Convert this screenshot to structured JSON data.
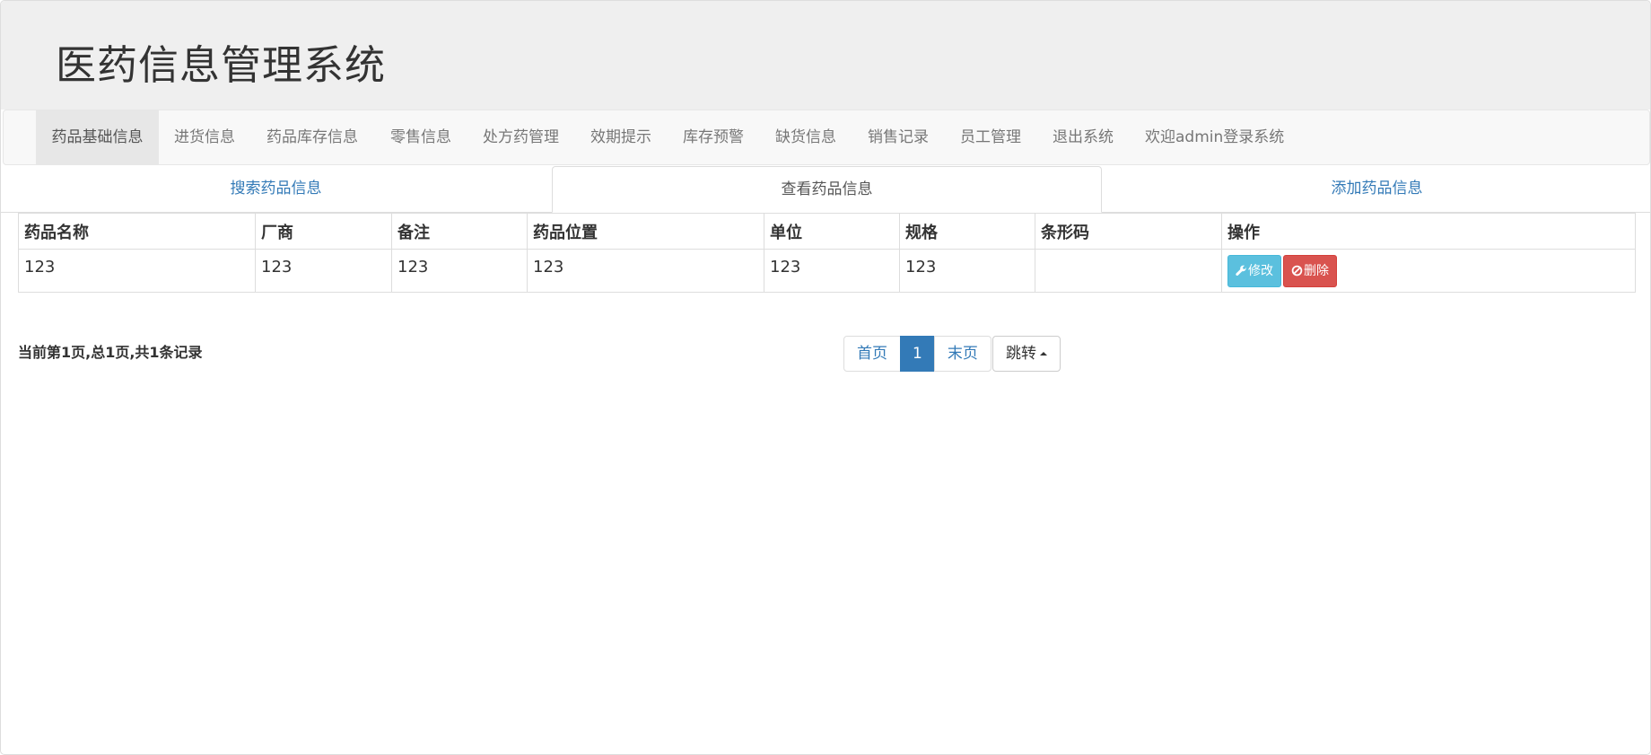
{
  "header": {
    "title": "医药信息管理系统"
  },
  "nav": {
    "items": [
      {
        "label": "药品基础信息",
        "active": true
      },
      {
        "label": "进货信息"
      },
      {
        "label": "药品库存信息"
      },
      {
        "label": "零售信息"
      },
      {
        "label": "处方药管理"
      },
      {
        "label": "效期提示"
      },
      {
        "label": "库存预警"
      },
      {
        "label": "缺货信息"
      },
      {
        "label": "销售记录"
      },
      {
        "label": "员工管理"
      },
      {
        "label": "退出系统"
      },
      {
        "label": "欢迎admin登录系统"
      }
    ]
  },
  "tabs": [
    {
      "label": "搜索药品信息"
    },
    {
      "label": "查看药品信息",
      "active": true
    },
    {
      "label": "添加药品信息"
    }
  ],
  "table": {
    "headers": [
      "药品名称",
      "厂商",
      "备注",
      "药品位置",
      "单位",
      "规格",
      "条形码",
      "操作"
    ],
    "rows": [
      {
        "cells": [
          "123",
          "123",
          "123",
          "123",
          "123",
          "123",
          ""
        ],
        "edit_label": "修改",
        "delete_label": "删除"
      }
    ]
  },
  "pagination": {
    "info": "当前第1页,总1页,共1条记录",
    "first_label": "首页",
    "current_page": "1",
    "last_label": "末页",
    "jump_label": "跳转"
  },
  "colors": {
    "link": "#337ab7",
    "info_button": "#5bc0de",
    "danger_button": "#d9534f",
    "header_bg": "#efefef",
    "navbar_bg": "#f8f8f8"
  },
  "icons": {
    "edit": "wrench-icon",
    "delete": "ban-icon"
  }
}
